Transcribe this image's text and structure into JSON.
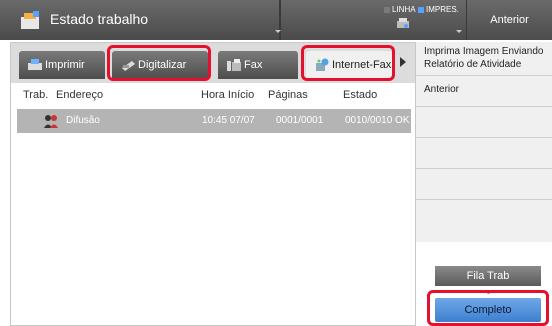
{
  "header": {
    "title": "Estado trabalho",
    "status_linha": "LINHA",
    "status_impres": "IMPRES.",
    "back_label": "Anterior",
    "colors": {
      "linha_dot": "#7a7a7a",
      "impres_dot": "#5aa0ff"
    }
  },
  "tabs": [
    {
      "label": "Imprimir",
      "icon": "printer-icon"
    },
    {
      "label": "Digitalizar",
      "icon": "scanner-icon",
      "highlighted": true
    },
    {
      "label": "Fax",
      "icon": "fax-icon"
    },
    {
      "label": "Internet-Fax",
      "icon": "internet-fax-icon",
      "selected": true,
      "highlighted": true
    }
  ],
  "table": {
    "columns": [
      "Trab.",
      "Endereço",
      "Hora Início",
      "Páginas",
      "Estado"
    ],
    "rows": [
      {
        "icon": "broadcast-icon",
        "address": "Difusão",
        "start_time": "10:45 07/07",
        "pages": "0001/0001",
        "status": "0010/0010 OK"
      }
    ]
  },
  "menu": {
    "items": [
      "Imprima Imagem Enviando\nRelatório de Atividade",
      "Anterior",
      "",
      "",
      "",
      ""
    ]
  },
  "buttons": {
    "queue_label": "Fila Trab",
    "complete_label": "Completo",
    "complete_highlighted": true
  },
  "colors": {
    "highlight": "#e3102e",
    "accent_blue": "#3d7fd0",
    "selected_row": "#b4b4b4"
  }
}
